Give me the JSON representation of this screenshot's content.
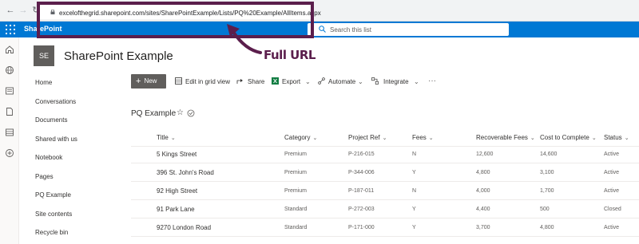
{
  "browser": {
    "url": "excelofthegrid.sharepoint.com/sites/SharePointExample/Lists/PQ%20Example/AllItems.aspx"
  },
  "suitebar": {
    "brand": "SharePoint",
    "search_placeholder": "Search this list"
  },
  "site": {
    "logo_initials": "SE",
    "title": "SharePoint Example"
  },
  "annotation": {
    "label": "Full URL",
    "color": "#5b1e4c"
  },
  "leftnav": {
    "items": [
      {
        "label": "Home"
      },
      {
        "label": "Conversations"
      },
      {
        "label": "Documents"
      },
      {
        "label": "Shared with us"
      },
      {
        "label": "Notebook"
      },
      {
        "label": "Pages"
      },
      {
        "label": "PQ Example"
      },
      {
        "label": "Site contents"
      },
      {
        "label": "Recycle bin"
      }
    ]
  },
  "commandbar": {
    "new_label": "New",
    "edit_grid_label": "Edit in grid view",
    "share_label": "Share",
    "export_label": "Export",
    "automate_label": "Automate",
    "integrate_label": "Integrate",
    "more_label": "···"
  },
  "list": {
    "title": "PQ Example",
    "columns": [
      "Title",
      "Category",
      "Project Ref",
      "Fees",
      "Recoverable Fees",
      "Cost to Complete",
      "Status"
    ],
    "rows": [
      [
        "5 Kings Street",
        "Premium",
        "P-216-015",
        "N",
        "12,600",
        "14,600",
        "Active"
      ],
      [
        "396 St. John's Road",
        "Premium",
        "P-344-006",
        "Y",
        "4,800",
        "3,100",
        "Active"
      ],
      [
        "92 High Street",
        "Premium",
        "P-187-011",
        "N",
        "4,000",
        "1,700",
        "Active"
      ],
      [
        "91 Park Lane",
        "Standard",
        "P-272-003",
        "Y",
        "4,400",
        "500",
        "Closed"
      ],
      [
        "9270 London Road",
        "Standard",
        "P-171-000",
        "Y",
        "3,700",
        "4,800",
        "Active"
      ]
    ]
  },
  "colors": {
    "suitebar": "#0078d4",
    "new_button": "#605e5c"
  }
}
